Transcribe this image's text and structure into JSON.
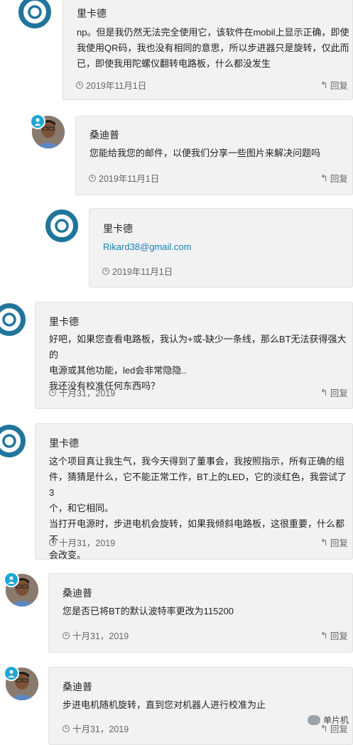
{
  "comments": [
    {
      "author": "里卡德",
      "body_lines": [
        "np。但是我仍然无法完全使用它，该软件在mobil上显示正确，即使",
        "我使用QR码，我也没有相同的意思，所以步进器只是旋转，仅此而",
        "已，即使我用陀螺仪翻转电路板，什么都没发生"
      ],
      "date": "2019年11月1日",
      "reply": "回复",
      "avatar": "wordpress-icon"
    },
    {
      "author": "桑迪普",
      "body_lines": [
        "您能给我您的邮件，以便我们分享一些图片来解决问题吗"
      ],
      "date": "2019年11月1日",
      "reply": "回复",
      "avatar": "user-photo"
    },
    {
      "author": "里卡德",
      "body_lines": [
        "Rikard38@gmail.com"
      ],
      "date": "2019年11月1日",
      "reply": "",
      "avatar": "wordpress-icon"
    },
    {
      "author": "里卡德",
      "body_lines": [
        "好吧，如果您查看电路板，我认为+或-缺少一条线，那么BT无法获得强大的",
        "电源或其他功能，led会非常隐隐..",
        "我还没有校准任何东西吗？"
      ],
      "date": "十月31，2019",
      "reply": "回复",
      "avatar": "wordpress-icon"
    },
    {
      "author": "里卡德",
      "body_lines": [
        "这个项目真让我生气，我今天得到了董事会，我按照指示，所有正确的组",
        "件，猜猜是什么，它不能正常工作，BT上的LED，它的淡红色，我尝试了3",
        "个，和它相同。",
        "当打开电源时，步进电机会旋转，如果我倾斜电路板，这很重要，什么都不",
        "会改变。"
      ],
      "date": "十月31，2019",
      "reply": "回复",
      "avatar": "wordpress-icon"
    },
    {
      "author": "桑迪普",
      "body_lines": [
        "您是否已将BT的默认波特率更改为115200"
      ],
      "date": "十月31，2019",
      "reply": "回复",
      "avatar": "user-photo"
    },
    {
      "author": "桑迪普",
      "body_lines": [
        "步进电机随机旋转，直到您对机器人进行校准为止"
      ],
      "date": "十月31，2019",
      "reply": "回复",
      "avatar": "user-photo"
    }
  ],
  "watermark": "单片机",
  "colors": {
    "wp_blue": "#21759b",
    "badge_blue": "#1fa6d5",
    "link": "#1a7fb5",
    "bubble_bg": "#f2f2f2"
  }
}
